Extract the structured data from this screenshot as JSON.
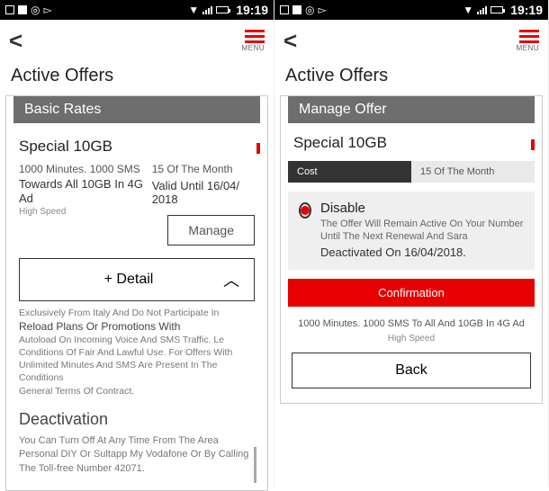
{
  "status": {
    "time": "19:19"
  },
  "header": {
    "menu_label": "MENU"
  },
  "left": {
    "page_title": "Active Offers",
    "section": "Basic Rates",
    "offer_name": "Special 10GB",
    "minutes_sms": "1000 Minutes. 1000 SMS",
    "towards": "Towards All 10GB In 4G Ad",
    "speed": "High Speed",
    "renew_day": "15 Of The Month",
    "valid_until": "Valid Until 16/04/\n2018",
    "manage_label": "Manage",
    "detail_label": "+ Detail",
    "fine1": "Exclusively From Italy And Do Not Participate In",
    "fine_reload": "Reload Plans Or Promotions With",
    "fine2": "Autoload On Incoming Voice And SMS Traffic. Le",
    "fine3": "Conditions Of Fair And Lawful Use. For Offers With Unlimited Minutes And SMS Are Present In The Conditions",
    "fine4": "General Terms Of Contract.",
    "deact_title": "Deactivation",
    "deact_text": "You Can Turn Off At Any Time From The Area Personal DIY Or Sultapp My Vodafone Or By Calling The Toll-free Number 42071."
  },
  "right": {
    "page_title": "Active Offers",
    "section": "Manage Offer",
    "offer_name": "Special 10GB",
    "tab_cost": "Cost",
    "tab_day": "15 Of The Month",
    "disable_title": "Disable",
    "disable_msg": "The Offer Will Remain Active On Your Number Until The Next Renewal And Sara",
    "disable_date": "Deactivated On 16/04/2018.",
    "confirm_label": "Confirmation",
    "summary": "1000 Minutes.  1000 SMS To All And 10GB In 4G Ad",
    "summary_sub": "High Speed",
    "back_label": "Back"
  }
}
